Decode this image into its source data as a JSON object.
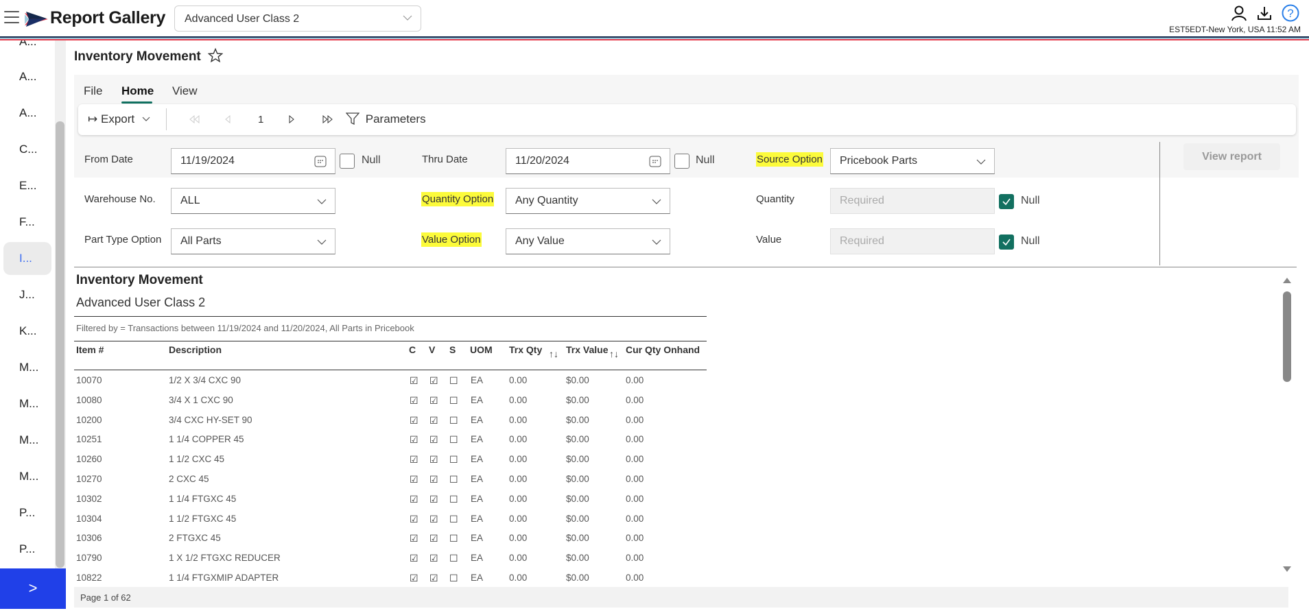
{
  "header": {
    "app_title": "Report Gallery",
    "class_selector": "Advanced User Class 2",
    "timezone_clock": "EST5EDT-New York, USA 11:52 AM",
    "icons": [
      "user-icon",
      "download-icon",
      "help-icon"
    ]
  },
  "sidebar": {
    "items": [
      {
        "label": "A..."
      },
      {
        "label": "A..."
      },
      {
        "label": "A..."
      },
      {
        "label": "C..."
      },
      {
        "label": "E..."
      },
      {
        "label": "F..."
      },
      {
        "label": "I...",
        "active": true
      },
      {
        "label": "J..."
      },
      {
        "label": "K..."
      },
      {
        "label": "M..."
      },
      {
        "label": "M..."
      },
      {
        "label": "M..."
      },
      {
        "label": "M..."
      },
      {
        "label": "P..."
      },
      {
        "label": "P..."
      }
    ],
    "expand_label": ">"
  },
  "report_header": {
    "title": "Inventory Movement",
    "favorite_icon": "star-outline-icon"
  },
  "ribbon": {
    "tabs": [
      {
        "label": "File"
      },
      {
        "label": "Home",
        "active": true
      },
      {
        "label": "View"
      }
    ],
    "toolbar": {
      "export_label": "Export",
      "page_number": "1",
      "parameters_label": "Parameters"
    }
  },
  "parameters": {
    "from_date": {
      "label": "From Date",
      "value": "11/19/2024",
      "null_label": "Null",
      "null_checked": false
    },
    "thru_date": {
      "label": "Thru Date",
      "value": "11/20/2024",
      "null_label": "Null",
      "null_checked": false
    },
    "source_option": {
      "label": "Source Option",
      "value": "Pricebook Parts",
      "highlighted": true
    },
    "warehouse": {
      "label": "Warehouse No.",
      "value": "ALL"
    },
    "quantity_option": {
      "label": "Quantity Option",
      "value": "Any Quantity",
      "highlighted": true
    },
    "quantity": {
      "label": "Quantity",
      "placeholder": "Required",
      "null_label": "Null",
      "null_checked": true
    },
    "part_type": {
      "label": "Part Type Option",
      "value": "All Parts"
    },
    "value_option": {
      "label": "Value Option",
      "value": "Any Value",
      "highlighted": true
    },
    "value": {
      "label": "Value",
      "placeholder": "Required",
      "null_label": "Null",
      "null_checked": true
    },
    "view_report_label": "View report"
  },
  "report": {
    "title": "Inventory Movement",
    "subtitle": "Advanced User Class 2",
    "filter_text": "Filtered by =  Transactions between 11/19/2024 and 11/20/2024, All Parts in Pricebook",
    "columns": [
      "Item #",
      "Description",
      "C",
      "V",
      "S",
      "UOM",
      "Trx Qty",
      "Trx Value",
      "Cur Qty Onhand"
    ],
    "rows": [
      {
        "item": "10070",
        "desc": "1/2 X 3/4 CXC 90",
        "c": "☑",
        "v": "☑",
        "s": "☐",
        "uom": "EA",
        "qty": "0.00",
        "value": "$0.00",
        "onhand": "0.00"
      },
      {
        "item": "10080",
        "desc": "3/4 X 1 CXC 90",
        "c": "☑",
        "v": "☑",
        "s": "☐",
        "uom": "EA",
        "qty": "0.00",
        "value": "$0.00",
        "onhand": "0.00"
      },
      {
        "item": "10200",
        "desc": "3/4 CXC HY-SET 90",
        "c": "☑",
        "v": "☑",
        "s": "☐",
        "uom": "EA",
        "qty": "0.00",
        "value": "$0.00",
        "onhand": "0.00"
      },
      {
        "item": "10251",
        "desc": "1 1/4 COPPER 45",
        "c": "☑",
        "v": "☑",
        "s": "☐",
        "uom": "EA",
        "qty": "0.00",
        "value": "$0.00",
        "onhand": "0.00"
      },
      {
        "item": "10260",
        "desc": "1 1/2 CXC 45",
        "c": "☑",
        "v": "☑",
        "s": "☐",
        "uom": "EA",
        "qty": "0.00",
        "value": "$0.00",
        "onhand": "0.00"
      },
      {
        "item": "10270",
        "desc": "2 CXC 45",
        "c": "☑",
        "v": "☑",
        "s": "☐",
        "uom": "EA",
        "qty": "0.00",
        "value": "$0.00",
        "onhand": "0.00"
      },
      {
        "item": "10302",
        "desc": "1 1/4 FTGXC 45",
        "c": "☑",
        "v": "☑",
        "s": "☐",
        "uom": "EA",
        "qty": "0.00",
        "value": "$0.00",
        "onhand": "0.00"
      },
      {
        "item": "10304",
        "desc": "1 1/2 FTGXC 45",
        "c": "☑",
        "v": "☑",
        "s": "☐",
        "uom": "EA",
        "qty": "0.00",
        "value": "$0.00",
        "onhand": "0.00"
      },
      {
        "item": "10306",
        "desc": "2 FTGXC 45",
        "c": "☑",
        "v": "☑",
        "s": "☐",
        "uom": "EA",
        "qty": "0.00",
        "value": "$0.00",
        "onhand": "0.00"
      },
      {
        "item": "10790",
        "desc": "1 X 1/2 FTGXC REDUCER",
        "c": "☑",
        "v": "☑",
        "s": "☐",
        "uom": "EA",
        "qty": "0.00",
        "value": "$0.00",
        "onhand": "0.00"
      },
      {
        "item": "10822",
        "desc": "1 1/4 FTGXMIP ADAPTER",
        "c": "☑",
        "v": "☑",
        "s": "☐",
        "uom": "EA",
        "qty": "0.00",
        "value": "$0.00",
        "onhand": "0.00"
      }
    ],
    "page_status": "Page 1 of 62"
  },
  "colors": {
    "accent_green": "#127060",
    "highlight_yellow": "#fcfb3b",
    "expand_blue": "#2040e8",
    "active_link": "#3b6cf0",
    "stripe_navy": "#14284b",
    "stripe_light_blue": "#9ec9db",
    "stripe_red": "#e84050"
  }
}
